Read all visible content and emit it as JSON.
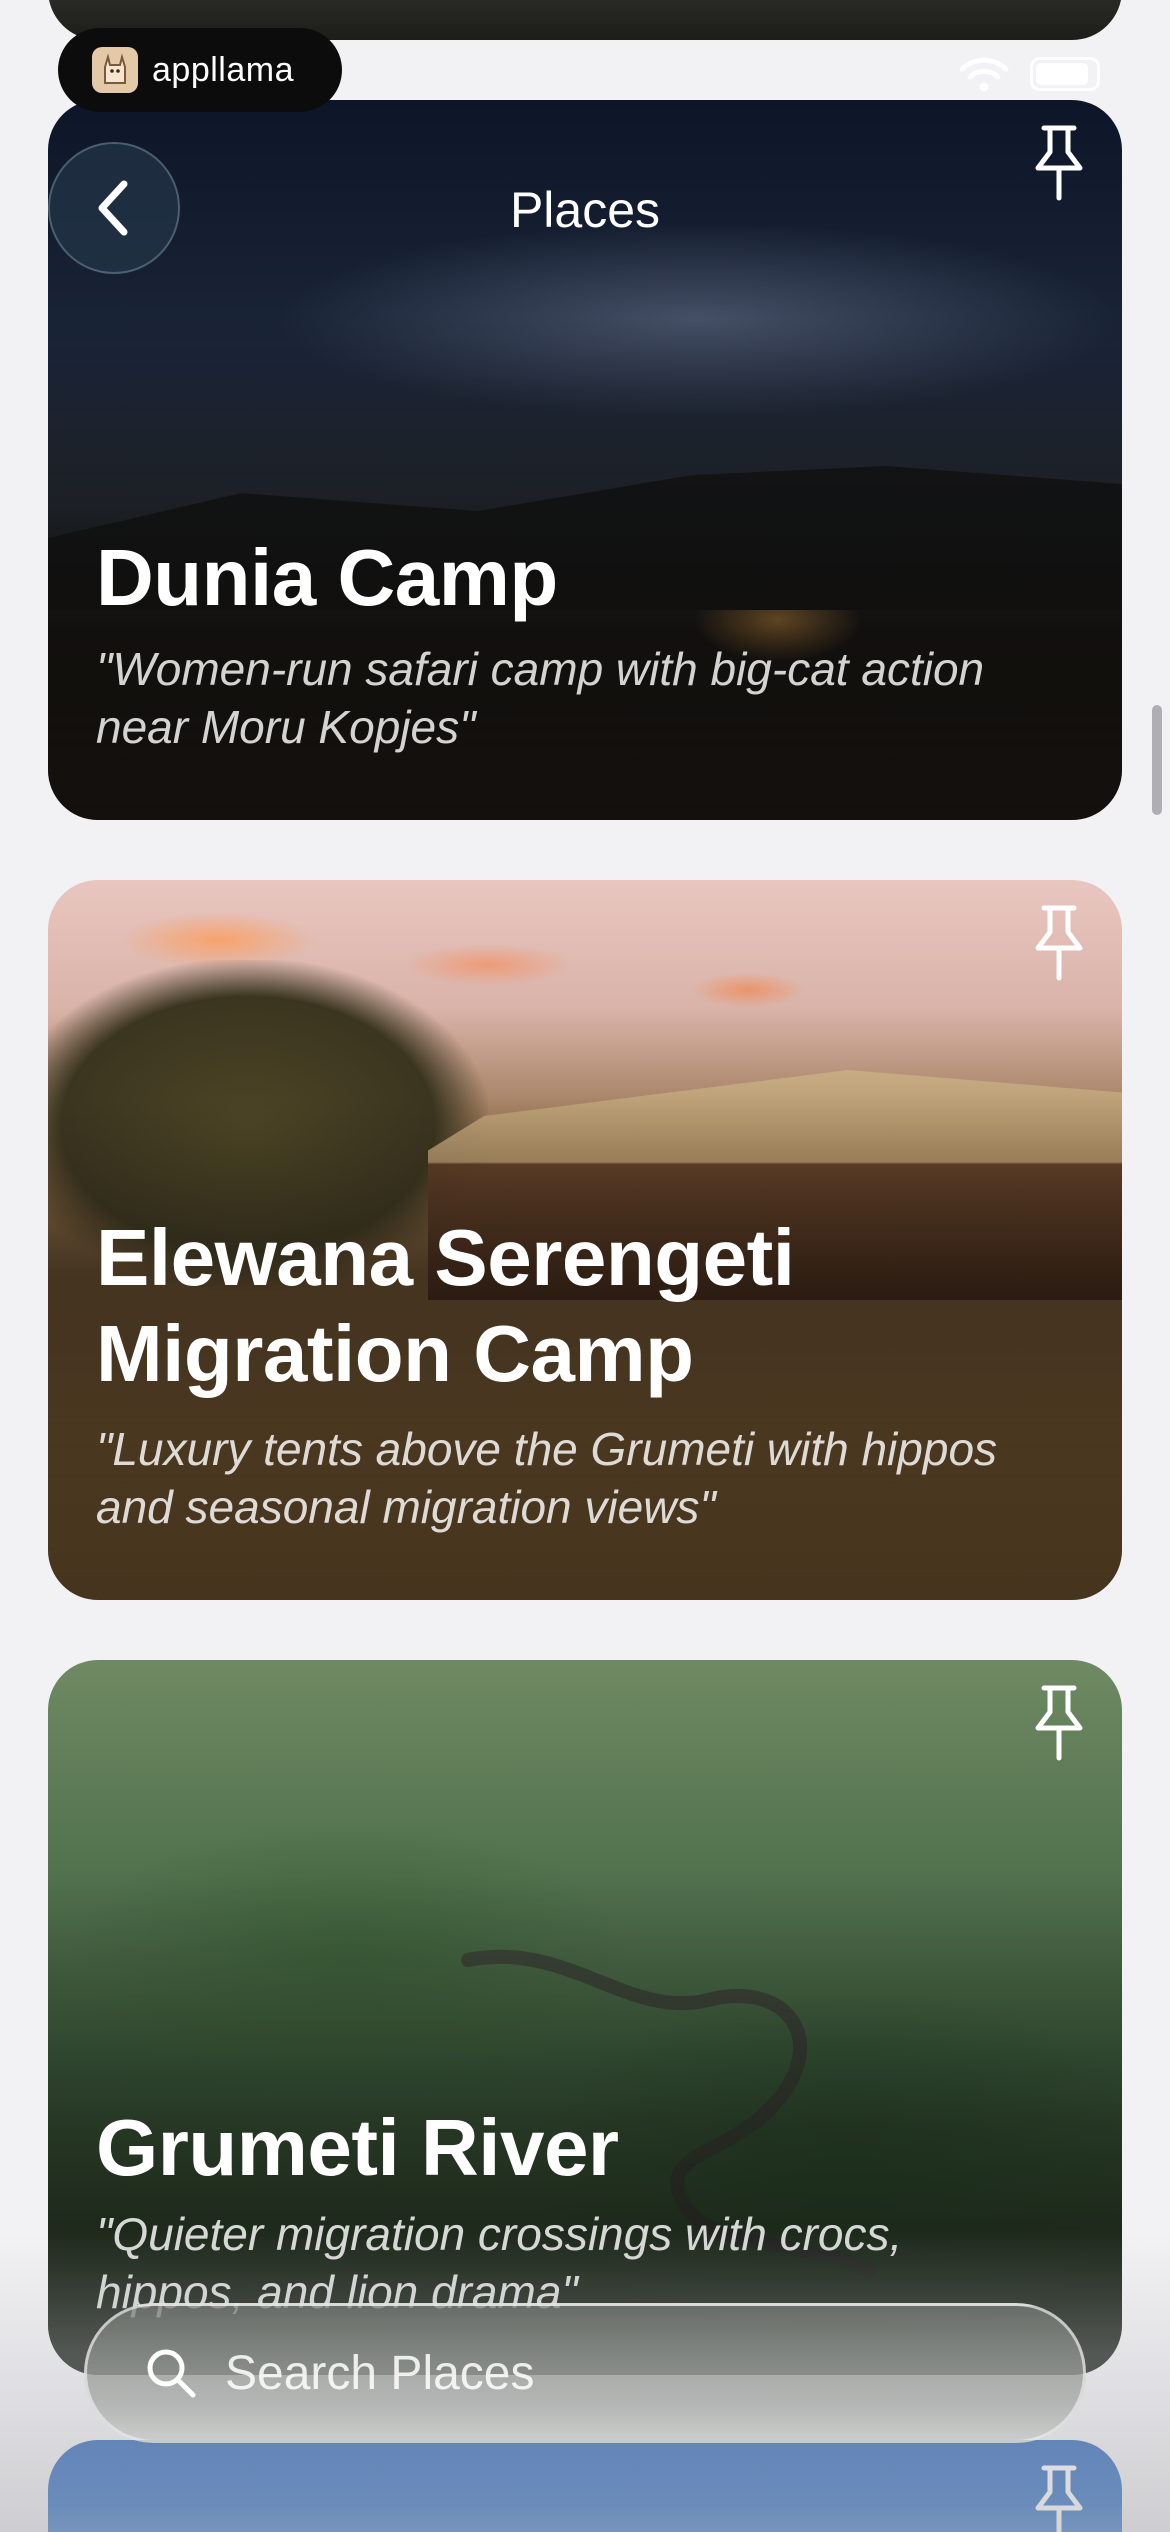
{
  "status_bar": {
    "app_badge": "appllama",
    "battery_level": 0.9
  },
  "header": {
    "title": "Places"
  },
  "places": [
    {
      "title": "Dunia Camp",
      "subtitle": "\"Women-run safari camp with big-cat action near Moru Kopjes\""
    },
    {
      "title": "Elewana Serengeti Migration Camp",
      "subtitle": "\"Luxury tents above the Grumeti with hippos and seasonal migration views\""
    },
    {
      "title": "Grumeti River",
      "subtitle": "\"Quieter migration crossings with crocs, hippos, and lion drama\""
    }
  ],
  "search": {
    "placeholder": "Search Places"
  },
  "icons": {
    "pin": "pin-icon",
    "back": "chevron-left-icon",
    "search": "search-icon",
    "wifi": "wifi-icon",
    "battery": "battery-icon"
  }
}
